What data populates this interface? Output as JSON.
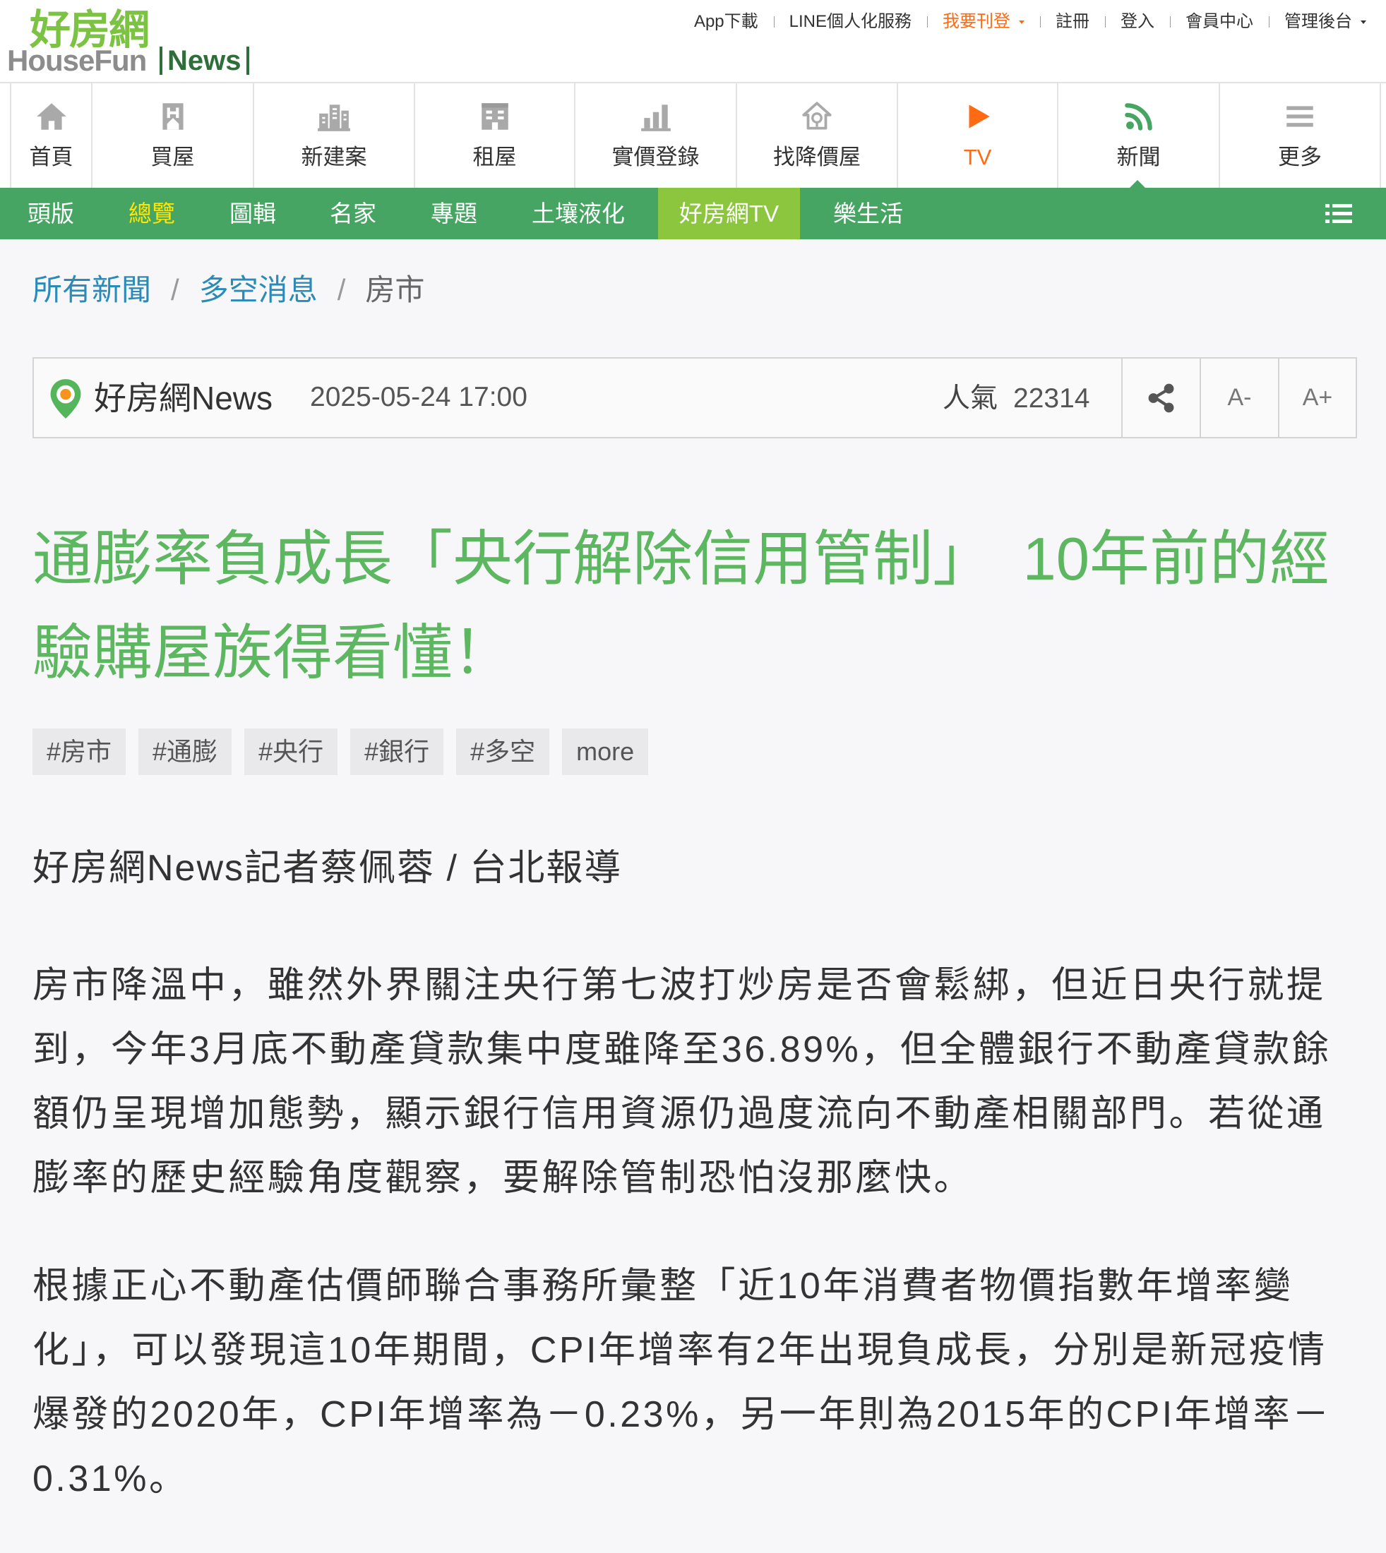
{
  "header": {
    "logo": {
      "chinese": "好房網",
      "brand": "HouseFun",
      "section": "News"
    },
    "top_links": [
      {
        "label": "App下載"
      },
      {
        "label": "LINE個人化服務"
      },
      {
        "label": "我要刊登",
        "has_dropdown": true,
        "highlighted": true
      },
      {
        "label": "註冊"
      },
      {
        "label": "登入"
      },
      {
        "label": "會員中心"
      },
      {
        "label": "管理後台",
        "has_dropdown": true
      }
    ]
  },
  "main_nav": [
    {
      "label": "首頁",
      "icon": "home-icon"
    },
    {
      "label": "買屋",
      "icon": "buy-house-icon"
    },
    {
      "label": "新建案",
      "icon": "new-building-icon"
    },
    {
      "label": "租屋",
      "icon": "rent-building-icon"
    },
    {
      "label": "實價登錄",
      "icon": "bar-chart-icon"
    },
    {
      "label": "找降價屋",
      "icon": "price-drop-house-icon"
    },
    {
      "label": "TV",
      "icon": "play-icon"
    },
    {
      "label": "新聞",
      "icon": "rss-icon",
      "active": true
    },
    {
      "label": "更多",
      "icon": "menu-icon"
    }
  ],
  "sub_nav": {
    "items": [
      {
        "label": "頭版"
      },
      {
        "label": "總覽",
        "active": true
      },
      {
        "label": "圖輯"
      },
      {
        "label": "名家"
      },
      {
        "label": "專題"
      },
      {
        "label": "土壤液化"
      },
      {
        "label": "好房網TV",
        "highlighted": true
      },
      {
        "label": "樂生活"
      }
    ],
    "menu_icon": "list-icon"
  },
  "breadcrumb": [
    "所有新聞",
    "多空消息",
    "房市"
  ],
  "article": {
    "info": {
      "source": "好房網News",
      "datetime": "2025-05-24 17:00",
      "views_label": "人氣",
      "views": "22314",
      "share_icon": "share-icon",
      "font_smaller": "A-",
      "font_larger": "A+"
    },
    "title": "通膨率負成長「央行解除信用管制」　10年前的經驗購屋族得看懂！",
    "tags": [
      "#房市",
      "#通膨",
      "#央行",
      "#銀行",
      "#多空"
    ],
    "more_label": "more",
    "byline": "好房網News記者蔡佩蓉 / 台北報導",
    "paragraphs": [
      "房市降溫中，雖然外界關注央行第七波打炒房是否會鬆綁，但近日央行就提到，今年3月底不動產貸款集中度雖降至36.89%，但全體銀行不動產貸款餘額仍呈現增加態勢，顯示銀行信用資源仍過度流向不動產相關部門。若從通膨率的歷史經驗角度觀察，要解除管制恐怕沒那麼快。",
      "根據正心不動產估價師聯合事務所彙整「近10年消費者物價指數年增率變化」，可以發現這10年期間，CPI年增率有2年出現負成長，分別是新冠疫情爆發的2020年，CPI年增率為－0.23%，另一年則為2015年的CPI年增率－0.31%。"
    ]
  },
  "colors": {
    "logo_green": "#7cc243",
    "nav_bar_green": "#47a563",
    "highlight_tab": "#8cc63f",
    "active_tab_text": "#ffe500",
    "title_green": "#5db760",
    "breadcrumb_link": "#2b8bb8",
    "accent_orange": "#ff6a13"
  }
}
